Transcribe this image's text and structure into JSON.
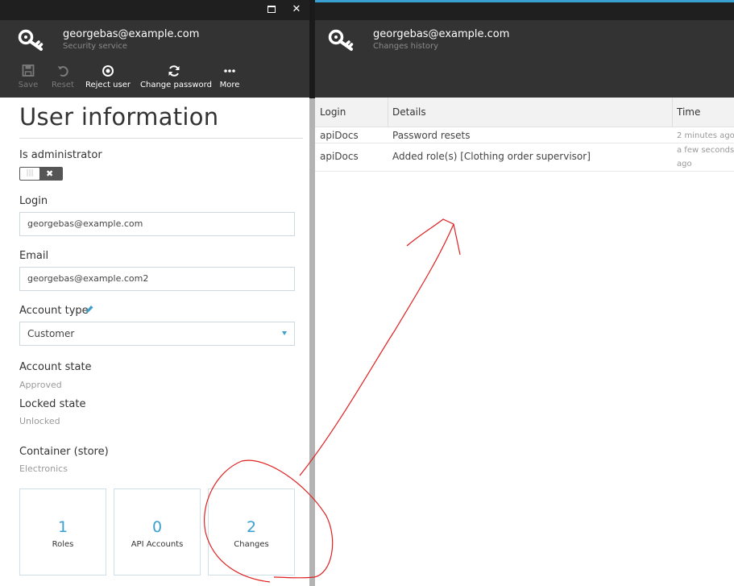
{
  "left_blade": {
    "header": {
      "title": "georgebas@example.com",
      "subtitle": "Security service"
    },
    "toolbar": {
      "save": "Save",
      "reset": "Reset",
      "reject_user": "Reject user",
      "change_password": "Change password",
      "more": "More"
    },
    "page_title": "User information",
    "is_administrator": {
      "label": "Is administrator",
      "value": false
    },
    "login": {
      "label": "Login",
      "value": "georgebas@example.com"
    },
    "email": {
      "label": "Email",
      "value": "georgebas@example.com2"
    },
    "account_type": {
      "label": "Account type",
      "value": "Customer"
    },
    "account_state": {
      "label": "Account state",
      "value": "Approved"
    },
    "locked_state": {
      "label": "Locked state",
      "value": "Unlocked"
    },
    "container": {
      "label": "Container (store)",
      "value": "Electronics"
    },
    "tiles": [
      {
        "count": "1",
        "label": "Roles"
      },
      {
        "count": "0",
        "label": "API Accounts"
      },
      {
        "count": "2",
        "label": "Changes"
      }
    ]
  },
  "right_blade": {
    "header": {
      "title": "georgebas@example.com",
      "subtitle": "Changes history"
    },
    "columns": [
      "Login",
      "Details",
      "Time"
    ],
    "rows": [
      {
        "login": "apiDocs",
        "details": "Password resets",
        "time": "2 minutes ago"
      },
      {
        "login": "apiDocs",
        "details": "Added role(s) [Clothing order supervisor]",
        "time": "a few seconds ago"
      }
    ]
  },
  "colors": {
    "accent": "#3aa0d0",
    "header_bg": "#333333",
    "annotation": "#e02020"
  },
  "icons": [
    "key-icon",
    "save-icon",
    "undo-icon",
    "reject-icon",
    "refresh-icon",
    "more-icon",
    "pencil-icon",
    "chevron-down-icon",
    "maximize-icon",
    "close-icon"
  ]
}
